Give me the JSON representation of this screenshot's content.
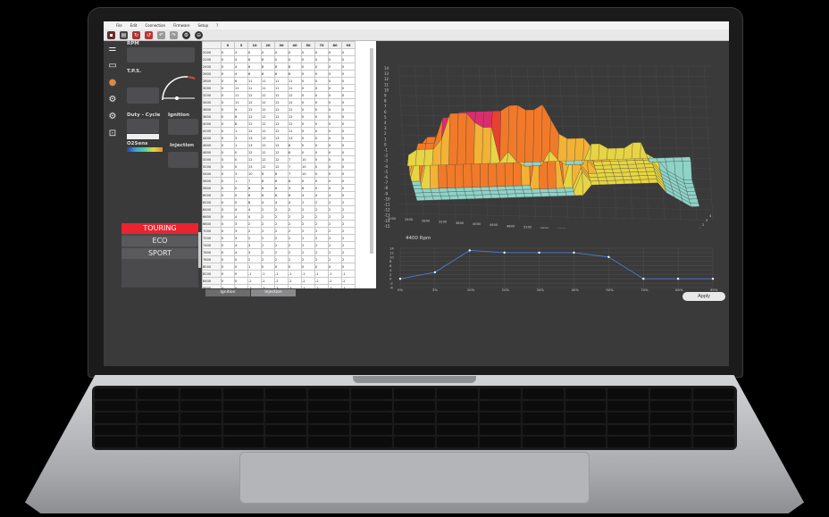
{
  "menu": [
    "File",
    "Edit",
    "Connection",
    "Firmware",
    "Setup",
    "?"
  ],
  "labels": {
    "rpm": "RPM",
    "tps": "T.P.S.",
    "duty_cycle": "Duty - Cycle",
    "ignition": "Ignition",
    "injection": "Injection",
    "o2sens": "O2Sens"
  },
  "modes": [
    "TOURING",
    "ECO",
    "SPORT"
  ],
  "active_mode": "TOURING",
  "table": {
    "col_headers": [
      "0",
      "3",
      "10",
      "20",
      "30",
      "40",
      "50",
      "70",
      "80",
      "95"
    ],
    "rows": [
      {
        "rpm": "2000",
        "v": [
          "0",
          "3",
          "0",
          "0",
          "0",
          "0",
          "0",
          "0",
          "0",
          "0"
        ]
      },
      {
        "rpm": "2200",
        "v": [
          "0",
          "4",
          "6",
          "6",
          "0",
          "0",
          "0",
          "0",
          "0",
          "0"
        ]
      },
      {
        "rpm": "2400",
        "v": [
          "0",
          "4",
          "6",
          "8",
          "8",
          "8",
          "0",
          "0",
          "0",
          "0"
        ]
      },
      {
        "rpm": "2600",
        "v": [
          "0",
          "4",
          "6",
          "8",
          "8",
          "8",
          "0",
          "0",
          "0",
          "0"
        ]
      },
      {
        "rpm": "2800",
        "v": [
          "0",
          "6",
          "11",
          "11",
          "11",
          "11",
          "0",
          "0",
          "0",
          "0"
        ]
      },
      {
        "rpm": "3000",
        "v": [
          "0",
          "11",
          "11",
          "11",
          "11",
          "11",
          "0",
          "0",
          "0",
          "0"
        ]
      },
      {
        "rpm": "3200",
        "v": [
          "0",
          "11",
          "12",
          "12",
          "12",
          "12",
          "0",
          "0",
          "0",
          "0"
        ]
      },
      {
        "rpm": "3400",
        "v": [
          "0",
          "11",
          "12",
          "12",
          "12",
          "12",
          "0",
          "0",
          "0",
          "0"
        ]
      },
      {
        "rpm": "3600",
        "v": [
          "0",
          "9",
          "12",
          "12",
          "12",
          "12",
          "0",
          "0",
          "0",
          "0"
        ]
      },
      {
        "rpm": "3800",
        "v": [
          "0",
          "8",
          "12",
          "12",
          "12",
          "12",
          "0",
          "0",
          "0",
          "0"
        ]
      },
      {
        "rpm": "4000",
        "v": [
          "0",
          "8",
          "12",
          "12",
          "12",
          "12",
          "0",
          "0",
          "0",
          "0"
        ]
      },
      {
        "rpm": "4200",
        "v": [
          "0",
          "1",
          "12",
          "12",
          "12",
          "11",
          "0",
          "0",
          "0",
          "0"
        ]
      },
      {
        "rpm": "4400",
        "v": [
          "0",
          "3",
          "13",
          "13",
          "13",
          "13",
          "0",
          "0",
          "0",
          "0"
        ]
      },
      {
        "rpm": "4600",
        "v": [
          "0",
          "1",
          "13",
          "12",
          "12",
          "8",
          "0",
          "0",
          "0",
          "0"
        ]
      },
      {
        "rpm": "4800",
        "v": [
          "0",
          "0",
          "12",
          "12",
          "12",
          "8",
          "0",
          "0",
          "0",
          "0"
        ]
      },
      {
        "rpm": "5000",
        "v": [
          "0",
          "0",
          "12",
          "12",
          "12",
          "7",
          "10",
          "0",
          "0",
          "0"
        ]
      },
      {
        "rpm": "5200",
        "v": [
          "0",
          "0",
          "13",
          "12",
          "12",
          "7",
          "10",
          "0",
          "0",
          "0"
        ]
      },
      {
        "rpm": "5400",
        "v": [
          "0",
          "3",
          "10",
          "8",
          "8",
          "7",
          "10",
          "0",
          "0",
          "0"
        ]
      },
      {
        "rpm": "5600",
        "v": [
          "0",
          "1",
          "7",
          "6",
          "6",
          "6",
          "0",
          "0",
          "0",
          "0"
        ]
      },
      {
        "rpm": "5800",
        "v": [
          "0",
          "0",
          "6",
          "6",
          "6",
          "3",
          "6",
          "0",
          "0",
          "0"
        ]
      },
      {
        "rpm": "6000",
        "v": [
          "0",
          "0",
          "6",
          "6",
          "6",
          "6",
          "4",
          "4",
          "4",
          "0"
        ]
      },
      {
        "rpm": "6200",
        "v": [
          "0",
          "0",
          "6",
          "4",
          "4",
          "4",
          "2",
          "2",
          "2",
          "2"
        ]
      },
      {
        "rpm": "6400",
        "v": [
          "0",
          "4",
          "4",
          "2",
          "2",
          "2",
          "2",
          "2",
          "2",
          "2"
        ]
      },
      {
        "rpm": "6600",
        "v": [
          "0",
          "4",
          "4",
          "2",
          "2",
          "2",
          "2",
          "2",
          "2",
          "2"
        ]
      },
      {
        "rpm": "6800",
        "v": [
          "0",
          "3",
          "2",
          "2",
          "2",
          "2",
          "2",
          "2",
          "2",
          "2"
        ]
      },
      {
        "rpm": "7000",
        "v": [
          "0",
          "3",
          "2",
          "2",
          "2",
          "2",
          "2",
          "2",
          "2",
          "2"
        ]
      },
      {
        "rpm": "7200",
        "v": [
          "0",
          "3",
          "2",
          "2",
          "2",
          "2",
          "2",
          "2",
          "2",
          "2"
        ]
      },
      {
        "rpm": "7400",
        "v": [
          "0",
          "4",
          "3",
          "2",
          "2",
          "2",
          "2",
          "2",
          "2",
          "2"
        ]
      },
      {
        "rpm": "7600",
        "v": [
          "0",
          "4",
          "3",
          "2",
          "2",
          "2",
          "2",
          "2",
          "2",
          "2"
        ]
      },
      {
        "rpm": "7800",
        "v": [
          "0",
          "0",
          "2",
          "2",
          "2",
          "2",
          "2",
          "2",
          "2",
          "2"
        ]
      },
      {
        "rpm": "8000",
        "v": [
          "0",
          "0",
          "1",
          "0",
          "0",
          "0",
          "0",
          "0",
          "0",
          "0"
        ]
      },
      {
        "rpm": "8200",
        "v": [
          "0",
          "0",
          "-1",
          "-1",
          "-1",
          "-1",
          "-1",
          "-1",
          "-1",
          "-1"
        ]
      },
      {
        "rpm": "8400",
        "v": [
          "0",
          "0",
          "-2",
          "-2",
          "-2",
          "-2",
          "-2",
          "-2",
          "-2",
          "-2"
        ]
      },
      {
        "rpm": "8600",
        "v": [
          "0",
          "0",
          "-3",
          "-3",
          "-3",
          "-3",
          "-3",
          "-3",
          "-3",
          "-3"
        ]
      },
      {
        "rpm": "8800",
        "v": [
          "0",
          "0",
          "-3",
          "-3",
          "-3",
          "-3",
          "-3",
          "-3",
          "-3",
          "-3"
        ]
      }
    ]
  },
  "tabs": [
    "Ignition",
    "Injection"
  ],
  "plot3d": {
    "z_ticks": [
      "14",
      "13",
      "12",
      "11",
      "10",
      "9",
      "8",
      "7",
      "6",
      "5",
      "4",
      "3",
      "2",
      "1",
      "0",
      "-1",
      "-2",
      "-3",
      "-4",
      "-5",
      "-6",
      "-7",
      "-8",
      "-9",
      "-10",
      "-11",
      "-12",
      "-13",
      "-14",
      "-15"
    ],
    "x_ticks": [
      "2000",
      "2400",
      "2800",
      "3200",
      "3600",
      "4000",
      "4400",
      "4800",
      "5200",
      "5600",
      "6000",
      "6400",
      "6800",
      "7200",
      "7600",
      "8000",
      "8400",
      "8800",
      "9600"
    ],
    "y_ticks": [
      "1",
      "2",
      "3",
      "4"
    ]
  },
  "chart_data": {
    "type": "line",
    "title": "4400 Rpm",
    "categories": [
      "0%",
      "3%",
      "10%",
      "20%",
      "30%",
      "40%",
      "50%",
      "70%",
      "80%",
      "95%"
    ],
    "series": [
      {
        "values": [
          0,
          3,
          13,
          12,
          12,
          12,
          10,
          0,
          0,
          0
        ]
      }
    ],
    "ylim": [
      -4,
      14
    ],
    "y_ticks": [
      "14",
      "12",
      "10",
      "8",
      "6",
      "4",
      "2",
      "0",
      "-2",
      "-4"
    ],
    "xlabel": "",
    "ylabel": ""
  },
  "apply_label": "Apply"
}
